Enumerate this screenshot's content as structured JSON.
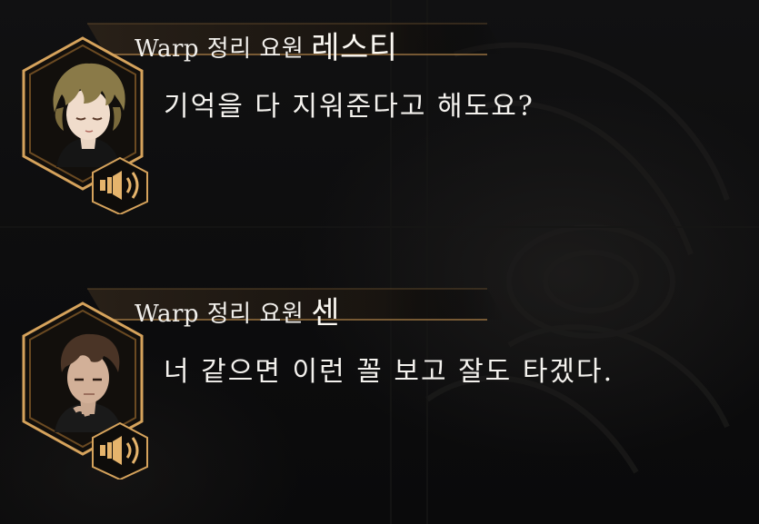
{
  "dialogue": [
    {
      "role": "Warp 정리 요원",
      "name": "레스티",
      "text": "기억을 다 지워준다고 해도요?",
      "portrait_icon": "blonde-character-portrait"
    },
    {
      "role": "Warp 정리 요원",
      "name": "센",
      "text": "너 같으면 이런 꼴 보고 잘도 타겠다.",
      "portrait_icon": "brown-haired-character-portrait"
    }
  ],
  "colors": {
    "accent_gold": "#d6a35c",
    "accent_dark": "#6b4a22",
    "text": "#f4f2ee",
    "background": "#0b0b0c"
  },
  "icons": {
    "voice": "speaker-voice-icon"
  }
}
